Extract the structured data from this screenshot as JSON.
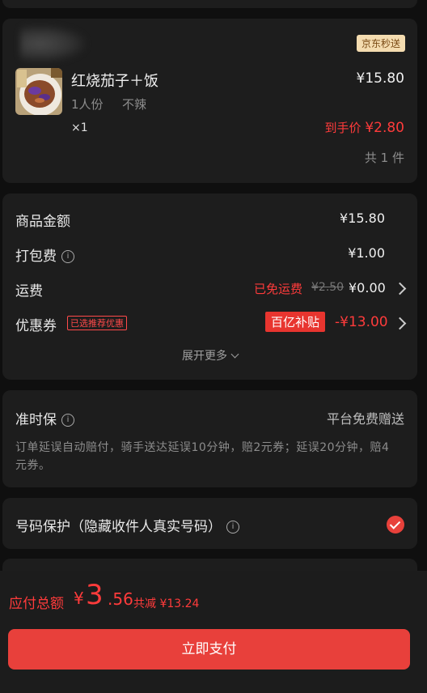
{
  "store": {
    "badge": "京东秒送"
  },
  "item": {
    "name": "红烧茄子＋饭",
    "price": "¥15.80",
    "spec_size": "1人份",
    "spec_spice": "不辣",
    "quantity": "×1",
    "final_price_label": "到手价",
    "final_price": "¥2.80",
    "count": "共 1 件"
  },
  "fees": {
    "subtotal_label": "商品金额",
    "subtotal": "¥15.80",
    "packing_label": "打包费",
    "packing": "¥1.00",
    "shipping_label": "运费",
    "shipping_free": "已免运费",
    "shipping_original": "¥2.50",
    "shipping": "¥0.00",
    "coupon_label": "优惠券",
    "coupon_tag": "已选推荐优惠",
    "coupon_subsidy": "百亿补贴",
    "coupon_discount": "-¥13.00",
    "expand": "展开更多"
  },
  "ontime": {
    "label": "准时保",
    "value": "平台免费赠送",
    "desc": "订单延误自动赔付，骑手送达延误10分钟，赔2元券；延误20分钟，赔4元券。"
  },
  "privacy": {
    "label": "号码保护（隐藏收件人真实号码）",
    "checked": true
  },
  "footer": {
    "total_label": "应付总额",
    "yen": "¥",
    "total_int": "3",
    "total_dec": ".56",
    "saved": "共减 ¥13.24",
    "pay_button": "立即支付"
  },
  "colors": {
    "accent": "#e8403b",
    "price_red": "#ff3b3b",
    "card_bg": "#1d1d1d",
    "page_bg": "#0f0f0f"
  }
}
